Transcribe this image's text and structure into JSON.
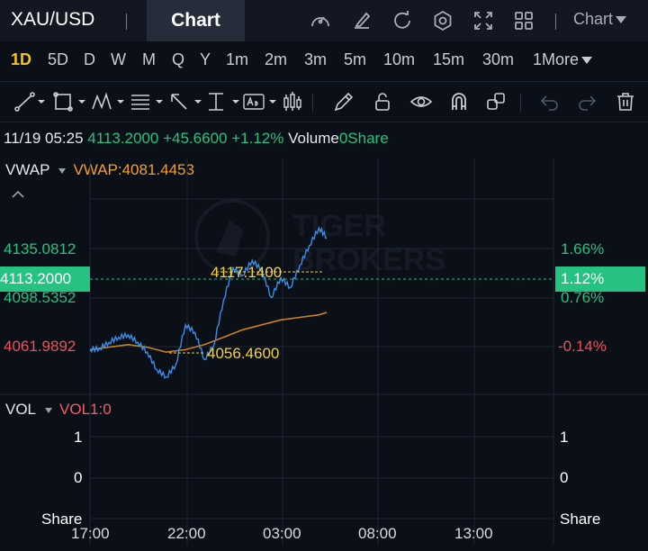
{
  "header": {
    "symbol": "XAU/USD",
    "tab_chart": "Chart",
    "chart_dropdown": "Chart",
    "icons": [
      "speedometer-icon",
      "edit-icon",
      "refresh-icon",
      "settings-icon",
      "fullscreen-icon",
      "grid-icon"
    ]
  },
  "periods": [
    "1D",
    "5D",
    "D",
    "W",
    "M",
    "Q",
    "Y",
    "1m",
    "2m",
    "3m",
    "5m",
    "10m",
    "15m",
    "30m",
    "1More"
  ],
  "active_period": "1D",
  "tools": [
    "line-tool-icon",
    "rectangle-tool-icon",
    "pattern-tool-icon",
    "fib-tool-icon",
    "arrow-tool-icon",
    "measure-tool-icon",
    "text-tool-icon",
    "indicator-tool-icon",
    "pencil-icon",
    "lock-icon",
    "eye-icon",
    "magnet-icon",
    "clone-icon",
    "undo-icon",
    "redo-icon",
    "trash-icon"
  ],
  "info": {
    "datetime": "11/19 05:25",
    "price": "4113.2000",
    "change": "+45.6600",
    "change_pct": "+1.12%",
    "volume_label": "Volume",
    "volume_value": "0Share"
  },
  "vwap": {
    "label": "VWAP",
    "value_text": "VWAP:4081.4453"
  },
  "price_axis": {
    "top": "4135.0812",
    "current": "4113.2000",
    "mid": "4098.5352",
    "low": "4061.9892"
  },
  "pct_axis": {
    "top": "1.66%",
    "current": "1.12%",
    "mid": "0.76%",
    "low": "-0.14%"
  },
  "annotations": {
    "high": "4117.1400",
    "low": "4056.4600"
  },
  "watermark": {
    "line1": "TIGER",
    "line2": "BROKERS"
  },
  "vol": {
    "label": "VOL",
    "value_text": "VOL1:0",
    "axis_left": [
      "1",
      "0",
      "Share"
    ],
    "axis_right": [
      "1",
      "0",
      "Share"
    ]
  },
  "time_axis": [
    "17:00",
    "22:00",
    "03:00",
    "08:00",
    "13:00"
  ],
  "colors": {
    "up": "#26c281",
    "down": "#f0505a",
    "vwap": "#f0a030",
    "price_line": "#3a8ee6",
    "active": "#f5c518"
  },
  "chart_data": {
    "type": "line",
    "series": [
      {
        "name": "price",
        "x": [
          "17:00",
          "17:30",
          "18:00",
          "18:30",
          "19:00",
          "19:30",
          "20:00",
          "20:30",
          "21:00",
          "21:30",
          "22:00",
          "22:30",
          "23:00",
          "23:30",
          "00:00",
          "00:30",
          "01:00",
          "01:30",
          "02:00",
          "02:30",
          "03:00",
          "03:30",
          "04:00",
          "04:30",
          "05:00",
          "05:25"
        ],
        "values": [
          4068,
          4068.5,
          4071,
          4073,
          4074,
          4071,
          4067,
          4060,
          4057,
          4062,
          4078,
          4075,
          4064,
          4070,
          4088,
          4101,
          4098,
          4104,
          4100,
          4089,
          4097,
          4093,
          4102,
          4110,
          4117,
          4113.2
        ]
      },
      {
        "name": "VWAP",
        "x": [
          "17:00",
          "18:00",
          "19:00",
          "20:00",
          "21:00",
          "22:00",
          "23:00",
          "00:00",
          "01:00",
          "02:00",
          "03:00",
          "04:00",
          "05:00",
          "05:25"
        ],
        "values": [
          4068,
          4069,
          4070,
          4069,
          4067,
          4068,
          4070,
          4073,
          4076,
          4078,
          4080,
          4081,
          4082,
          4083
        ]
      }
    ],
    "ylim": [
      4050,
      4145
    ],
    "volume": [
      0
    ]
  }
}
